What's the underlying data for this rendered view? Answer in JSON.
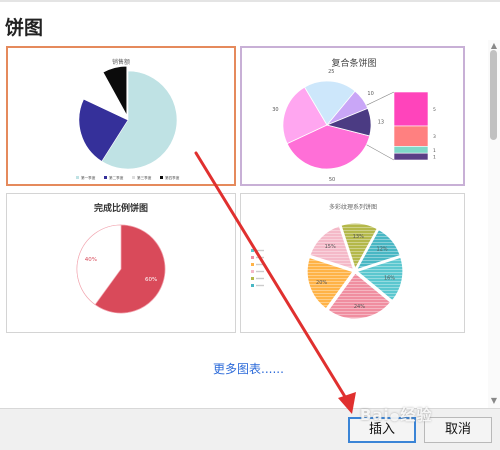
{
  "section_title": "饼图",
  "more_link": "更多图表......",
  "buttons": {
    "insert": "插入",
    "cancel": "取消"
  },
  "watermark": "Bai 经验",
  "colors": {
    "accent_arrow": "#e0302f",
    "selected_border": "#e58a5c",
    "link": "#2d6bd9"
  },
  "icons": {
    "scroll_up": "▲",
    "scroll_down": "▼"
  },
  "cards": [
    {
      "name": "销售额",
      "chart_data": {
        "type": "pie",
        "title": "销售额",
        "slices": [
          {
            "name": "第一季度",
            "value": 59,
            "color": "#bfe2e4"
          },
          {
            "name": "第二季度",
            "value": 23,
            "color": "#35309a"
          },
          {
            "name": "第三季度",
            "value": 10,
            "color": "#ffffff"
          },
          {
            "name": "第四季度",
            "value": 8,
            "color": "#0b0b0b"
          }
        ],
        "legend": [
          "第一季度",
          "第二季度",
          "第三季度",
          "第四季度"
        ],
        "legend_position": "bottom"
      }
    },
    {
      "name": "复合条饼图",
      "chart_data": {
        "type": "pie",
        "title": "复合条饼图",
        "slices": [
          {
            "value": 50,
            "label": "50",
            "color": "#ff6fd7"
          },
          {
            "value": 30,
            "label": "30",
            "color": "#ffa6f0"
          },
          {
            "value": 25,
            "label": "25",
            "color": "#cde7fb"
          },
          {
            "value": 10,
            "label": "10",
            "color": "#c9a6f7"
          },
          {
            "value": 13,
            "label": "13",
            "color": "#4b3b83"
          }
        ],
        "bar": [
          {
            "value": 5,
            "label": "5",
            "color": "#ff44bb"
          },
          {
            "value": 3,
            "label": "3",
            "color": "#ff8080"
          },
          {
            "value": 1,
            "label": "1",
            "color": "#7fd8c8"
          },
          {
            "value": 1,
            "label": "1",
            "color": "#5a3f86"
          }
        ]
      }
    },
    {
      "name": "完成比例饼图",
      "chart_data": {
        "type": "pie",
        "title": "完成比例饼图",
        "slices": [
          {
            "value": 60,
            "label": "60%",
            "color": "#d94a5a"
          },
          {
            "value": 40,
            "label": "40%",
            "color": "#ffffff"
          }
        ]
      }
    },
    {
      "name": "多彩纹理系列饼图",
      "chart_data": {
        "type": "pie",
        "title": "多彩纹理系列饼图",
        "slices": [
          {
            "value": 16,
            "label": "16%",
            "color": "#5bc7cf"
          },
          {
            "value": 24,
            "label": "24%",
            "color": "#f08ea0"
          },
          {
            "value": 20,
            "label": "20%",
            "color": "#ffb347"
          },
          {
            "value": 15,
            "label": "15%",
            "color": "#f4b9c8"
          },
          {
            "value": 13,
            "label": "13%",
            "color": "#b4b84a"
          },
          {
            "value": 12,
            "label": "12%",
            "color": "#49b7c4"
          }
        ]
      }
    }
  ]
}
